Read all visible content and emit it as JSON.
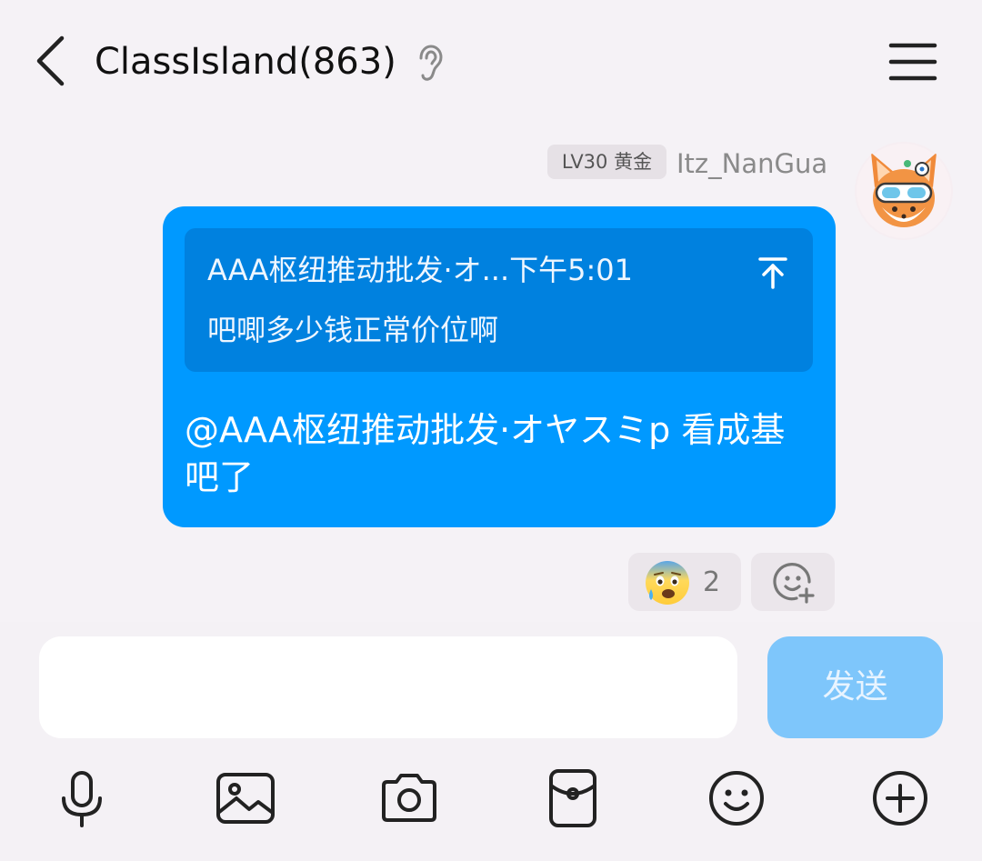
{
  "header": {
    "title": "ClassIsland(863)",
    "back_icon": "chevron-left-icon",
    "mode_icon": "ear-icon",
    "menu_icon": "hamburger-menu-icon"
  },
  "message": {
    "level_badge": "LV30 黄金",
    "sender": "Itz_NanGua",
    "quote": {
      "header": "AAA枢纽推动批发·オ...下午5:01",
      "text": "吧唧多少钱正常价位啊"
    },
    "text": "@AAA枢纽推动批发·オヤスミp 看成基吧了",
    "reaction": {
      "emoji": "anxious-face-with-sweat",
      "count": "2"
    }
  },
  "composer": {
    "input_value": "",
    "send_label": "发送"
  },
  "toolbar": {
    "items": [
      "microphone-icon",
      "image-icon",
      "camera-icon",
      "red-packet-icon",
      "emoji-icon",
      "plus-icon"
    ]
  },
  "colors": {
    "bubble": "#0099ff",
    "quote_bg": "#0081df",
    "send_button": "#7ec6fb",
    "background": "#f5f2f6"
  }
}
